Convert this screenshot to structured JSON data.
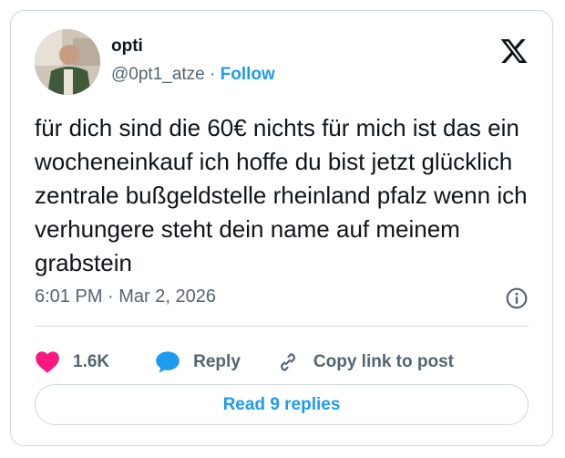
{
  "author": {
    "name": "opti",
    "handle": "@0pt1_atze",
    "separator": "·",
    "follow_label": "Follow"
  },
  "tweet": {
    "text": "für dich sind die 60€ nichts für mich ist das ein wocheneinkauf ich hoffe du bist jetzt glücklich zentrale bußgeldstelle rheinland pfalz wenn ich verhungere steht dein name auf meinem grabstein",
    "timestamp": "6:01 PM · Mar 2, 2026"
  },
  "actions": {
    "like_count": "1.6K",
    "reply_label": "Reply",
    "copy_label": "Copy link to post"
  },
  "read_replies_label": "Read 9 replies",
  "icons": {
    "brand": "x-logo-icon",
    "info": "info-icon",
    "like": "heart-icon",
    "reply": "speech-bubble-icon",
    "copy": "link-icon"
  },
  "colors": {
    "accent": "#1d9bf0",
    "like": "#f91880",
    "text": "#0f1419",
    "muted": "#536471",
    "border": "#cfd9de"
  }
}
